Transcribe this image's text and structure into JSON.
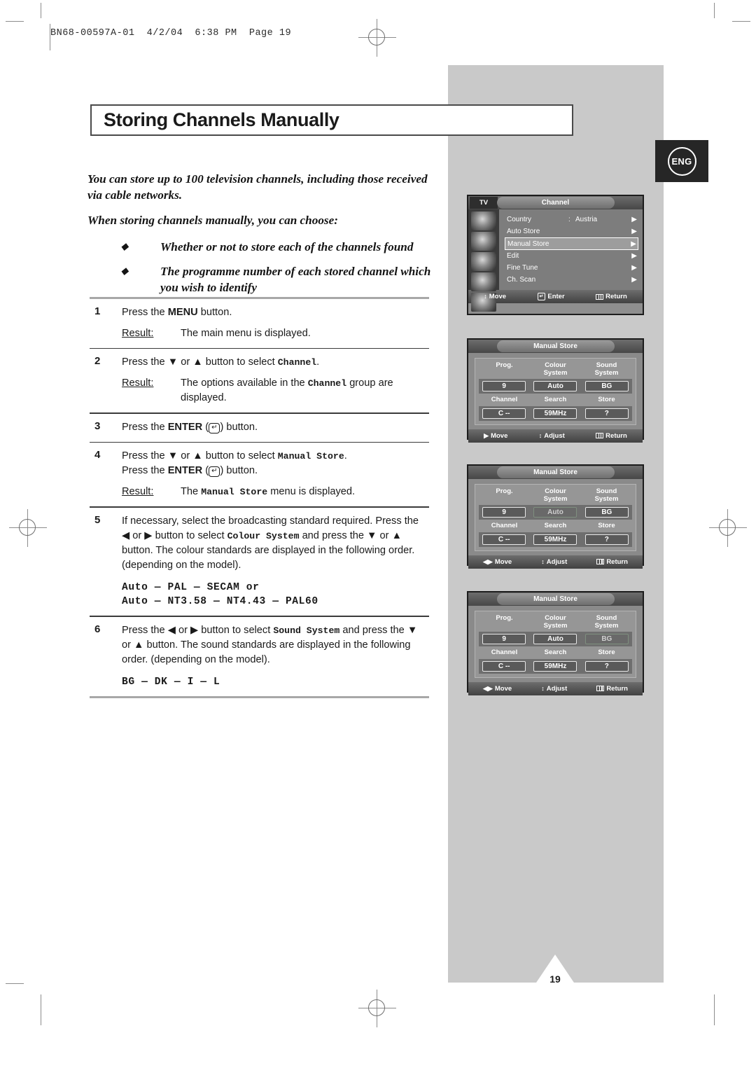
{
  "prepress": {
    "header_line": "BN68-00597A-01  4/2/04  6:38 PM  Page 19"
  },
  "page": {
    "title": "Storing Channels Manually",
    "language_badge": "ENG",
    "page_number": "19"
  },
  "intro": {
    "paragraph1": "You can store up to 100 television channels, including those received via cable networks.",
    "paragraph2": "When storing channels manually, you can choose:",
    "bullet_symbol": "◆",
    "bullets": [
      "Whether or not to store each of the channels found",
      "The programme number of each stored channel which you wish to identify"
    ]
  },
  "steps": [
    {
      "number": "1",
      "lines": [
        "Press the MENU button."
      ],
      "bold_terms": [
        "MENU"
      ],
      "result_label": "Result:",
      "result_text": "The main menu is displayed."
    },
    {
      "number": "2",
      "lines": [
        "Press the ▼ or ▲ button to select Channel."
      ],
      "mono_terms": [
        "Channel"
      ],
      "result_label": "Result:",
      "result_text": "The options available in the Channel group are displayed."
    },
    {
      "number": "3",
      "lines": [
        "Press the ENTER ( ) button."
      ],
      "bold_terms": [
        "ENTER"
      ]
    },
    {
      "number": "4",
      "lines": [
        "Press the ▼ or ▲ button to select Manual Store.",
        "Press the ENTER ( ) button."
      ],
      "mono_terms": [
        "Manual Store"
      ],
      "result_label": "Result:",
      "result_text": "The Manual Store menu is displayed."
    },
    {
      "number": "5",
      "lines": [
        "If necessary, select the broadcasting standard required. Press the ◀ or ▶ button to select Colour System and press the ▼ or ▲ button. The colour standards are displayed in the following order. (depending on the model)."
      ],
      "mono_terms": [
        "Colour System"
      ],
      "code_lines": [
        "Auto — PAL — SECAM or",
        "Auto — NT3.58 — NT4.43 — PAL60"
      ]
    },
    {
      "number": "6",
      "lines": [
        "Press the ◀ or ▶ button to select Sound System and press the ▼ or ▲ button. The sound standards are displayed in the following order. (depending on the model)."
      ],
      "mono_terms": [
        "Sound System"
      ],
      "code_lines": [
        "BG — DK — I — L"
      ]
    }
  ],
  "osd_channel_menu": {
    "tv_tab": "TV",
    "title": "Channel",
    "rows": [
      {
        "label": "Country",
        "colon": ":",
        "value": "Austria",
        "arrow": "▶",
        "selected": false
      },
      {
        "label": "Auto Store",
        "colon": "",
        "value": "",
        "arrow": "▶",
        "selected": false
      },
      {
        "label": "Manual Store",
        "colon": "",
        "value": "",
        "arrow": "▶",
        "selected": true
      },
      {
        "label": "Edit",
        "colon": "",
        "value": "",
        "arrow": "▶",
        "selected": false
      },
      {
        "label": "Fine Tune",
        "colon": "",
        "value": "",
        "arrow": "▶",
        "selected": false
      },
      {
        "label": "Ch. Scan",
        "colon": "",
        "value": "",
        "arrow": "▶",
        "selected": false
      }
    ],
    "footer": [
      {
        "icon": "updown-arrow-icon",
        "glyph": "↕",
        "label": "Move"
      },
      {
        "icon": "enter-key-icon",
        "glyph": "↵",
        "label": "Enter"
      },
      {
        "icon": "return-menu-icon",
        "glyph": "",
        "label": "Return"
      }
    ]
  },
  "osd_manual_store_panels": [
    {
      "title": "Manual Store",
      "headers_row1": [
        "Prog.",
        "Colour\nSystem",
        "Sound\nSystem"
      ],
      "values_row1": [
        "9",
        "Auto",
        "BG"
      ],
      "headers_row2": [
        "Channel",
        "Search",
        "Store"
      ],
      "values_row2": [
        "C --",
        "59MHz",
        "?"
      ],
      "highlighted_value": "9",
      "footer": [
        {
          "icon": "right-arrow-icon",
          "glyph": "▶",
          "label": "Move"
        },
        {
          "icon": "updown-arrow-icon",
          "glyph": "↕",
          "label": "Adjust"
        },
        {
          "icon": "return-menu-icon",
          "glyph": "",
          "label": "Return"
        }
      ]
    },
    {
      "title": "Manual Store",
      "headers_row1": [
        "Prog.",
        "Colour\nSystem",
        "Sound\nSystem"
      ],
      "values_row1": [
        "9",
        "Auto",
        "BG"
      ],
      "headers_row2": [
        "Channel",
        "Search",
        "Store"
      ],
      "values_row2": [
        "C --",
        "59MHz",
        "?"
      ],
      "highlighted_value": "Auto",
      "footer": [
        {
          "icon": "leftright-arrow-icon",
          "glyph": "◀▶",
          "label": "Move"
        },
        {
          "icon": "updown-arrow-icon",
          "glyph": "↕",
          "label": "Adjust"
        },
        {
          "icon": "return-menu-icon",
          "glyph": "",
          "label": "Return"
        }
      ]
    },
    {
      "title": "Manual Store",
      "headers_row1": [
        "Prog.",
        "Colour\nSystem",
        "Sound\nSystem"
      ],
      "values_row1": [
        "9",
        "Auto",
        "BG"
      ],
      "headers_row2": [
        "Channel",
        "Search",
        "Store"
      ],
      "values_row2": [
        "C --",
        "59MHz",
        "?"
      ],
      "highlighted_value": "BG",
      "footer": [
        {
          "icon": "leftright-arrow-icon",
          "glyph": "◀▶",
          "label": "Move"
        },
        {
          "icon": "updown-arrow-icon",
          "glyph": "↕",
          "label": "Adjust"
        },
        {
          "icon": "return-menu-icon",
          "glyph": "",
          "label": "Return"
        }
      ]
    }
  ],
  "colors": {
    "band_gray": "#c9c9c9",
    "badge_dark": "#262626",
    "rule_gray": "#a8a8a8",
    "text": "#1a1a1a"
  }
}
